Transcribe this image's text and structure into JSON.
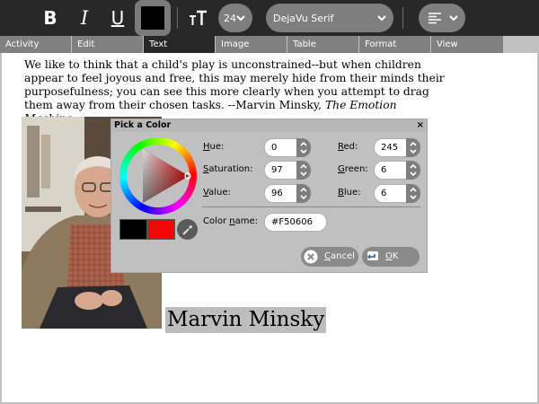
{
  "toolbar": {
    "bold_label": "B",
    "italic_label": "I",
    "underline_label": "U",
    "text_color": "#000000",
    "font_size": "24",
    "font_family": "DejaVu Serif"
  },
  "tabs": [
    {
      "label": "Activity"
    },
    {
      "label": "Edit"
    },
    {
      "label": "Text"
    },
    {
      "label": "Image"
    },
    {
      "label": "Table"
    },
    {
      "label": "Format"
    },
    {
      "label": "View"
    }
  ],
  "active_tab": "Text",
  "document": {
    "quote_main": "We like to think that a child's play is unconstrained--but when children appear to feel joyous and free, this may merely hide from their minds their purposefulness; you can see this more clearly when you attempt to drag them away from their chosen tasks. --Marvin Minsky, ",
    "quote_source": "The Emotion Machine",
    "caption": "Marvin Minsky"
  },
  "color_dialog": {
    "title": "Pick a Color",
    "close_label": "×",
    "hue_label_pre": "",
    "hue_label_key": "H",
    "hue_label_post": "ue:",
    "hue_value": "0",
    "saturation_label_pre": "",
    "saturation_label_key": "S",
    "saturation_label_post": "aturation:",
    "saturation_value": "97",
    "value_label_pre": "",
    "value_label_key": "V",
    "value_label_post": "alue:",
    "value_value": "96",
    "red_label_pre": "",
    "red_label_key": "R",
    "red_label_post": "ed:",
    "red_value": "245",
    "green_label_pre": "",
    "green_label_key": "G",
    "green_label_post": "reen:",
    "green_value": "6",
    "blue_label_pre": "",
    "blue_label_key": "B",
    "blue_label_post": "lue:",
    "blue_value": "6",
    "color_name_label_pre": "Color ",
    "color_name_label_key": "n",
    "color_name_label_post": "ame:",
    "color_name_value": "#F50606",
    "previous_color": "#000000",
    "current_color": "#F50606",
    "cancel_label_pre": "",
    "cancel_label_key": "C",
    "cancel_label_post": "ancel",
    "ok_label_pre": "",
    "ok_label_key": "O",
    "ok_label_post": "K"
  }
}
